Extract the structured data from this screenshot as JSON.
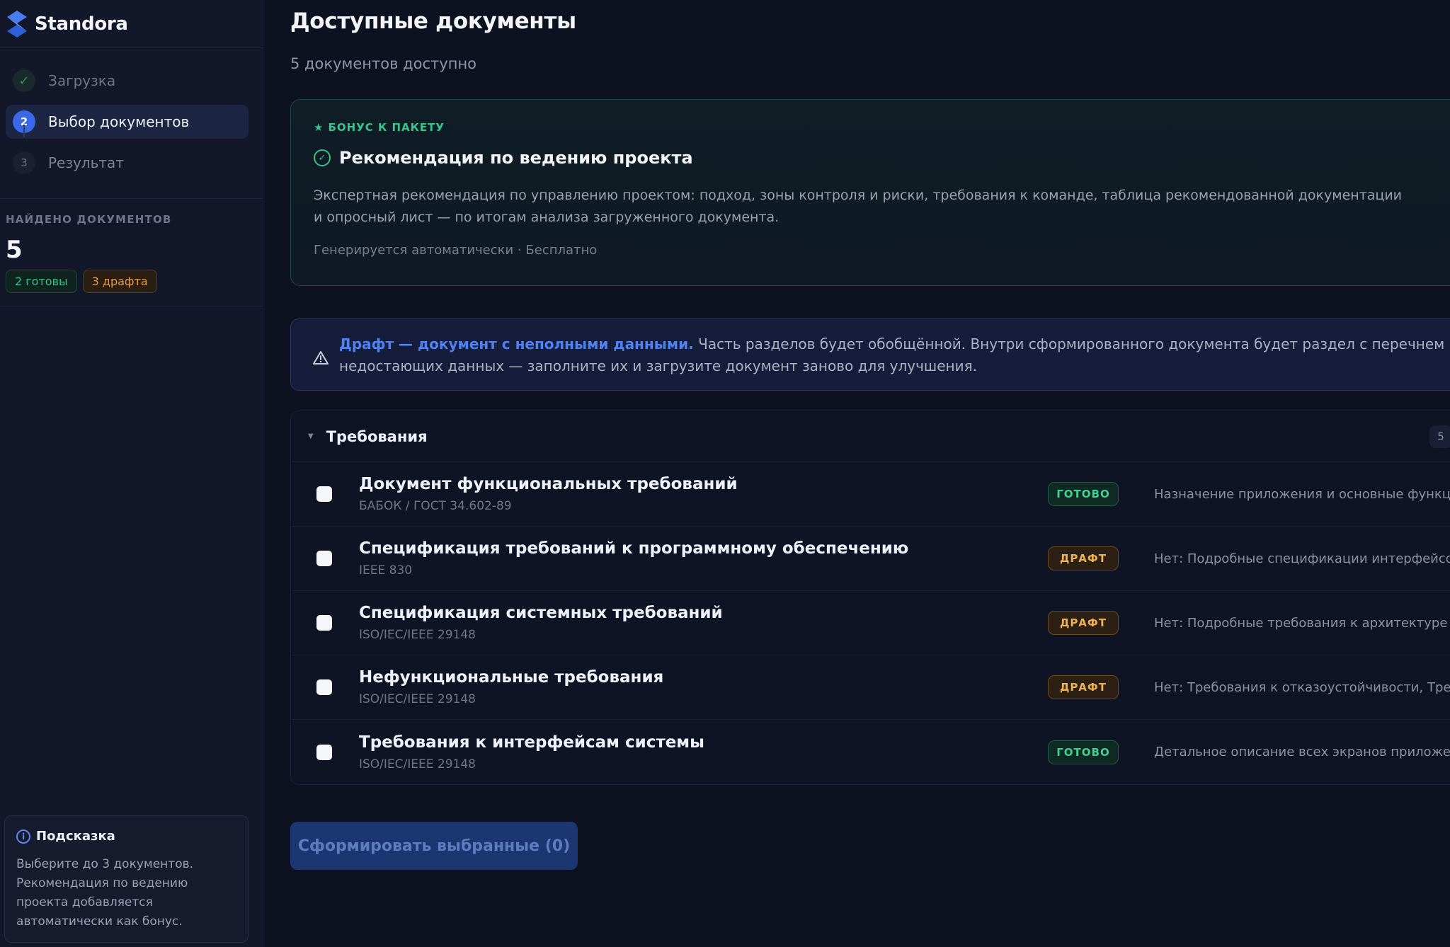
{
  "app": {
    "brand": "Standora"
  },
  "sidebar": {
    "steps": [
      {
        "num": "✓",
        "label": "Загрузка",
        "state": "done"
      },
      {
        "num": "2",
        "label": "Выбор документов",
        "state": "active"
      },
      {
        "num": "3",
        "label": "Результат",
        "state": "pending"
      }
    ],
    "found": {
      "title": "НАЙДЕНО ДОКУМЕНТОВ",
      "count": "5",
      "ready_chip": "2 готовы",
      "draft_chip": "3 драфта"
    },
    "hint": {
      "title": "Подсказка",
      "text": "Выберите до 3 документов. Рекомендация по ведению проекта добавляется автоматически как бонус."
    }
  },
  "main": {
    "title": "Доступные документы",
    "subtitle": "5 документов доступно",
    "bonus": {
      "tag": "БОНУС К ПАКЕТУ",
      "title": "Рекомендация по ведению проекта",
      "description": "Экспертная рекомендация по управлению проектом: подход, зоны контроля и риски, требования к команде, таблица рекомендованной документации и опросный лист — по итогам анализа загруженного документа.",
      "meta": "Генерируется автоматически · Бесплатно"
    },
    "warning": {
      "strong": "Драфт — документ с неполными данными.",
      "text": " Часть разделов будет обобщённой. Внутри сформированного документа будет раздел с перечнем недостающих данных — заполните их и загрузите документ заново для улучшения."
    },
    "group": {
      "title": "Требования",
      "count": "5",
      "documents": [
        {
          "title": "Документ функциональных требований",
          "standard": "БАБОК / ГОСТ 34.602-89",
          "status": "ГОТОВО",
          "status_kind": "ready",
          "note": "Назначение приложения и основные функциона..."
        },
        {
          "title": "Спецификация требований к программному обеспечению",
          "standard": "IEEE 830",
          "status": "ДРАФТ",
          "status_kind": "draft",
          "note": "Нет: Подробные спецификации интерфейсов вза..."
        },
        {
          "title": "Спецификация системных требований",
          "standard": "ISO/IEC/IEEE 29148",
          "status": "ДРАФТ",
          "status_kind": "draft",
          "note": "Нет: Подробные требования к архитектуре сист..."
        },
        {
          "title": "Нефункциональные требования",
          "standard": "ISO/IEC/IEEE 29148",
          "status": "ДРАФТ",
          "status_kind": "draft",
          "note": "Нет: Требования к отказоустойчивости, Требова..."
        },
        {
          "title": "Требования к интерфейсам системы",
          "standard": "ISO/IEC/IEEE 29148",
          "status": "ГОТОВО",
          "status_kind": "ready",
          "note": "Детальное описание всех экранов приложения, ..."
        }
      ]
    },
    "submit_label": "Сформировать выбранные (0)"
  },
  "colors": {
    "accent": "#3a68e8",
    "success": "#36c08b",
    "warning": "#f0b054",
    "background": "#0d1120"
  }
}
